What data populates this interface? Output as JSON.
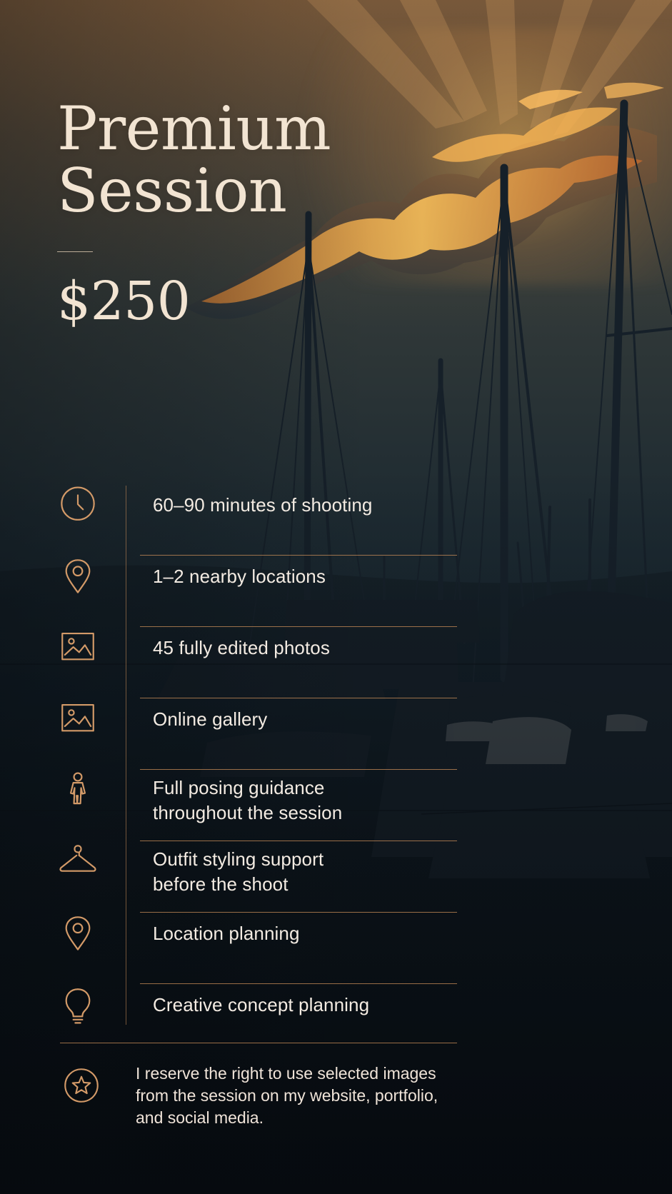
{
  "page": {
    "title_lines": [
      "Premium",
      "Session"
    ],
    "price": "$250"
  },
  "features": [
    {
      "icon": "clock-icon",
      "text": "60–90 minutes of shooting"
    },
    {
      "icon": "location-pin-icon",
      "text": "1–2 nearby locations"
    },
    {
      "icon": "image-icon",
      "text": "45 fully edited photos"
    },
    {
      "icon": "image-icon",
      "text": "Online gallery"
    },
    {
      "icon": "person-icon",
      "text": "Full posing guidance\nthroughout the session"
    },
    {
      "icon": "hanger-icon",
      "text": "Outfit styling support\nbefore the shoot"
    },
    {
      "icon": "location-pin-icon",
      "text": "Location planning"
    },
    {
      "icon": "lightbulb-icon",
      "text": "Creative concept planning"
    }
  ],
  "note": {
    "icon": "star-badge-icon",
    "text": "I reserve the right to use selected images\nfrom the session on my website, portfolio,\nand social media."
  },
  "colors": {
    "accent": "#D39A68",
    "text": "#F3EBE2",
    "background": "#0B1117"
  }
}
